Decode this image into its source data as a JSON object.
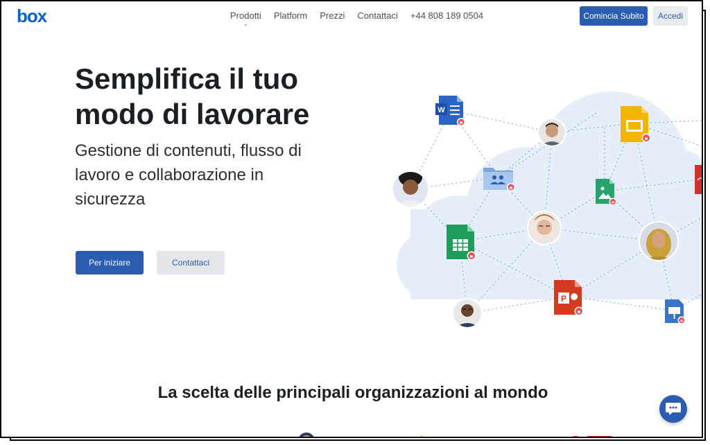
{
  "nav": {
    "logo": "box",
    "links": [
      "Prodotti",
      "Platform",
      "Prezzi",
      "Contattaci",
      "+44 808 189 0504"
    ],
    "cta_start": "Comincia Subito",
    "cta_login": "Accedi"
  },
  "hero": {
    "title": "Semplifica il tuo modo di lavorare",
    "subtitle": "Gestione di contenuti, flusso di lavoro e collaborazione in sicurezza",
    "primary_button": "Per iniziare",
    "secondary_button": "Contattaci"
  },
  "section": {
    "title": "La scelta delle principali organizzazioni al mondo"
  },
  "colors": {
    "brand_blue": "#2a5db0",
    "logo_blue": "#0061d5",
    "word_blue": "#2b64c7",
    "slides_yellow": "#f4b400",
    "sheets_green": "#1e9c5a",
    "ppt_red": "#d33b1f",
    "cloud_blue": "#e6eef8"
  },
  "icons": [
    "word-file-icon",
    "google-slides-icon",
    "shared-folder-icon",
    "image-file-icon",
    "google-sheets-icon",
    "powerpoint-file-icon",
    "keynote-file-icon",
    "pdf-file-icon",
    "lock-badge-icon",
    "chat-icon"
  ]
}
